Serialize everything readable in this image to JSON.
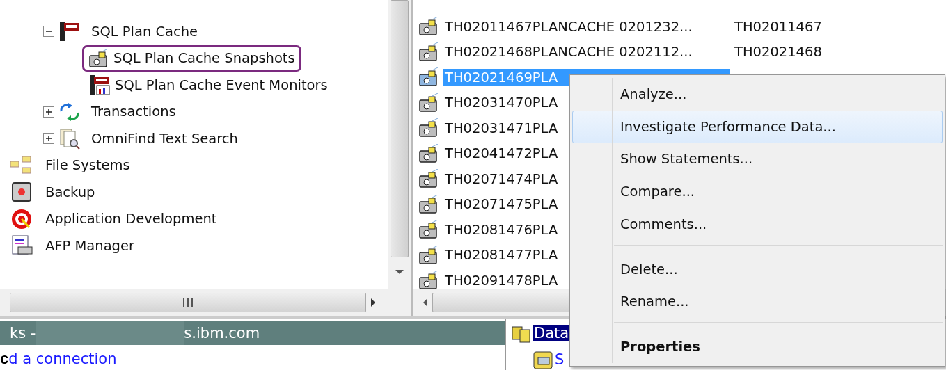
{
  "tree": {
    "branch": [
      {
        "label": "SQL Plan Cache",
        "expanded": true,
        "children": [
          {
            "label": "SQL Plan Cache Snapshots",
            "highlighted": true
          },
          {
            "label": "SQL Plan Cache Event Monitors",
            "highlighted": false
          }
        ]
      },
      {
        "label": "Transactions",
        "expanded": false
      },
      {
        "label": "OmniFind Text Search",
        "expanded": false
      }
    ],
    "items": [
      {
        "label": "File Systems"
      },
      {
        "label": "Backup"
      },
      {
        "label": "Application Development"
      },
      {
        "label": "AFP Manager"
      }
    ]
  },
  "list": {
    "rows": [
      {
        "name": "TH02011467PLANCACHE 0201232...",
        "column_2": "TH02011467",
        "selected": false
      },
      {
        "name": "TH02021468PLANCACHE 0202112...",
        "column_2": "TH02021468",
        "selected": false
      },
      {
        "name": "TH02021469PLA",
        "selected": true
      },
      {
        "name": "TH02031470PLA",
        "selected": false
      },
      {
        "name": "TH02031471PLA",
        "selected": false
      },
      {
        "name": "TH02041472PLA",
        "selected": false
      },
      {
        "name": "TH02071474PLA",
        "selected": false
      },
      {
        "name": "TH02071475PLA",
        "selected": false
      },
      {
        "name": "TH02081476PLA",
        "selected": false
      },
      {
        "name": "TH02081477PLA",
        "selected": false
      },
      {
        "name": "TH02091478PLA",
        "selected": false
      }
    ]
  },
  "context_menu": [
    {
      "kind": "item",
      "label": "Analyze...",
      "selected": false
    },
    {
      "kind": "item",
      "label": "Investigate Performance Data...",
      "selected": true
    },
    {
      "kind": "item",
      "label": "Show Statements...",
      "selected": false
    },
    {
      "kind": "item",
      "label": "Compare...",
      "selected": false
    },
    {
      "kind": "item",
      "label": "Comments...",
      "selected": false
    },
    {
      "kind": "separator"
    },
    {
      "kind": "item",
      "label": "Delete...",
      "selected": false
    },
    {
      "kind": "item",
      "label": "Rename...",
      "selected": false
    },
    {
      "kind": "separator"
    },
    {
      "kind": "default",
      "label": "Properties",
      "selected": false
    }
  ],
  "bottom": {
    "title_start": "ks - ",
    "title_end": "s.ibm.com",
    "cut_letter": "c",
    "link": "d a connection",
    "right_item": "Data",
    "right_link": "S"
  }
}
